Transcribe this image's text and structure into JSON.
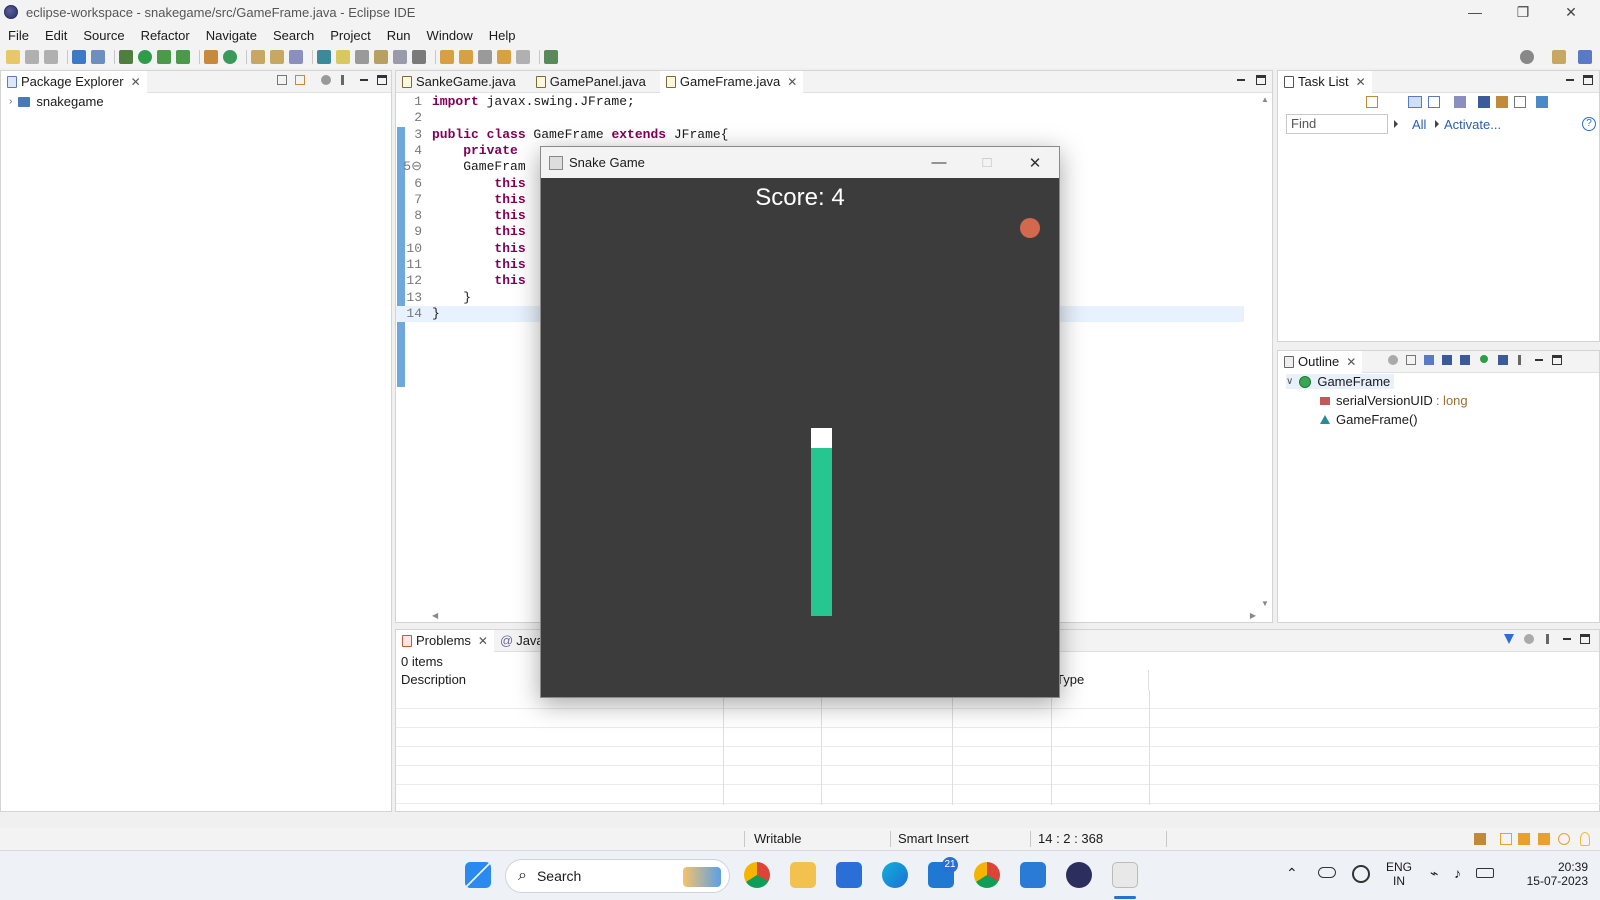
{
  "window": {
    "title": "eclipse-workspace - snakegame/src/GameFrame.java - Eclipse IDE"
  },
  "menubar": [
    "File",
    "Edit",
    "Source",
    "Refactor",
    "Navigate",
    "Search",
    "Project",
    "Run",
    "Window",
    "Help"
  ],
  "package_explorer": {
    "tab_label": "Package Explorer",
    "project": "snakegame"
  },
  "editor": {
    "tabs": [
      {
        "label": "SankeGame.java",
        "active": false
      },
      {
        "label": "GamePanel.java",
        "active": false
      },
      {
        "label": "GameFrame.java",
        "active": true
      }
    ],
    "lines": [
      {
        "n": "1",
        "kw": "import",
        "rest": " javax.swing.JFrame;"
      },
      {
        "n": "2",
        "kw": "",
        "rest": ""
      },
      {
        "n": "3",
        "kw": "public class",
        "rest": " GameFrame ",
        "kw2": "extends",
        "rest2": " JFrame{"
      },
      {
        "n": "4",
        "kw": "    private",
        "rest": ""
      },
      {
        "n": "5⊖",
        "kw": "",
        "rest": "    GameFram"
      },
      {
        "n": "6",
        "kw": "        this",
        "rest": ""
      },
      {
        "n": "7",
        "kw": "        this",
        "rest": ""
      },
      {
        "n": "8",
        "kw": "        this",
        "rest": ""
      },
      {
        "n": "9",
        "kw": "        this",
        "rest": ""
      },
      {
        "n": "10",
        "kw": "        this",
        "rest": ""
      },
      {
        "n": "11",
        "kw": "        this",
        "rest": ""
      },
      {
        "n": "12",
        "kw": "        this",
        "rest": ""
      },
      {
        "n": "13",
        "kw": "",
        "rest": "    }"
      },
      {
        "n": "14",
        "kw": "",
        "rest": "}"
      }
    ]
  },
  "task_list": {
    "tab_label": "Task List",
    "find_placeholder": "Find",
    "all_label": "All",
    "activate_label": "Activate..."
  },
  "outline": {
    "tab_label": "Outline",
    "class_name": "GameFrame",
    "field_name": "serialVersionUID",
    "field_type": ": long",
    "constructor": "GameFrame()"
  },
  "problems": {
    "tab_label": "Problems",
    "second_tab_label": "Java",
    "items_text": "0 items",
    "col_description": "Description",
    "col_type": "Type"
  },
  "statusbar": {
    "writable": "Writable",
    "insert_mode": "Smart Insert",
    "position": "14 : 2 : 368"
  },
  "snake_game": {
    "title": "Snake Game",
    "score_text": "Score: 4",
    "apple_color": "#d2694f",
    "head_color": "#ffffff",
    "body_color": "#26c690",
    "board_color": "#3c3c3c"
  },
  "taskbar": {
    "search_label": "Search",
    "mail_badge": "21",
    "lang_top": "ENG",
    "lang_bottom": "IN",
    "time": "20:39",
    "date": "15-07-2023"
  },
  "colors": {
    "keyword": "#7f0055",
    "link": "#2a5db0",
    "current_line": "#e8f2fe"
  }
}
